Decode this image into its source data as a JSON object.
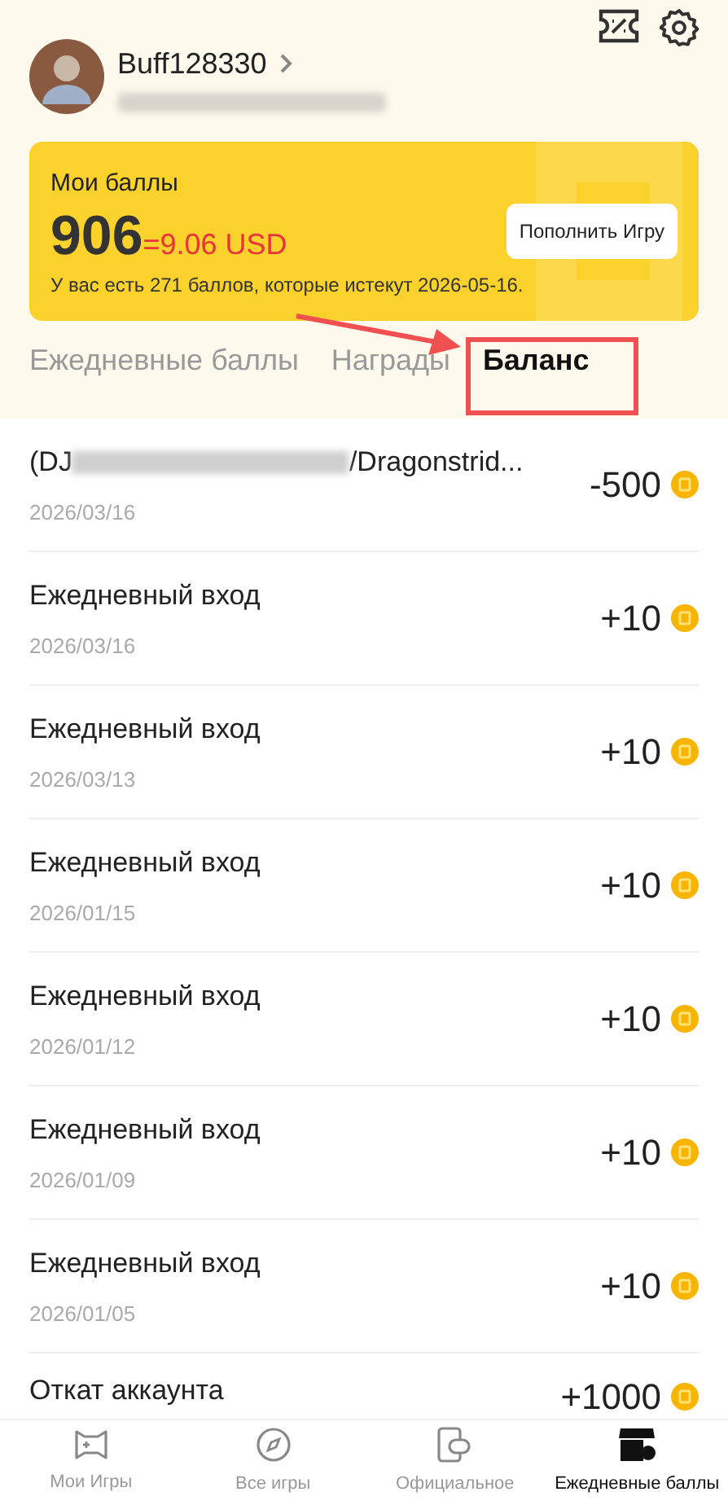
{
  "profile": {
    "username": "Buff128330"
  },
  "points_card": {
    "title": "Мои баллы",
    "points": "906",
    "conversion": "=9.06 USD",
    "topup_button": "Пополнить Игру",
    "expiry_note": "У вас есть 271 баллов, которые истекут 2026-05-16."
  },
  "tabs": [
    {
      "label": "Ежедневные баллы",
      "selected": false
    },
    {
      "label": "Награды",
      "selected": false
    },
    {
      "label": "Баланс",
      "selected": true
    }
  ],
  "transactions": [
    {
      "title_start": "(DJ",
      "redacted": true,
      "title_end": "/Dragonstrid...",
      "date": "2026/03/16",
      "amount": "-500"
    },
    {
      "title_start": "Ежедневный вход",
      "redacted": false,
      "date": "2026/03/16",
      "amount": "+10"
    },
    {
      "title_start": "Ежедневный вход",
      "redacted": false,
      "date": "2026/03/13",
      "amount": "+10"
    },
    {
      "title_start": "Ежедневный вход",
      "redacted": false,
      "date": "2026/01/15",
      "amount": "+10"
    },
    {
      "title_start": "Ежедневный вход",
      "redacted": false,
      "date": "2026/01/12",
      "amount": "+10"
    },
    {
      "title_start": "Ежедневный вход",
      "redacted": false,
      "date": "2026/01/09",
      "amount": "+10"
    },
    {
      "title_start": "Ежедневный вход",
      "redacted": false,
      "date": "2026/01/05",
      "amount": "+10"
    },
    {
      "title_start": "Откат аккаунта",
      "redacted": false,
      "amount": "+1000"
    }
  ],
  "bottom_nav": [
    {
      "kind": "gamepad",
      "label": "Мои Игры",
      "selected": false
    },
    {
      "kind": "compass",
      "label": "Все игры",
      "selected": false
    },
    {
      "kind": "phone",
      "label": "Официальное",
      "selected": false
    },
    {
      "kind": "store",
      "label": "Ежедневные баллы",
      "selected": true
    }
  ]
}
